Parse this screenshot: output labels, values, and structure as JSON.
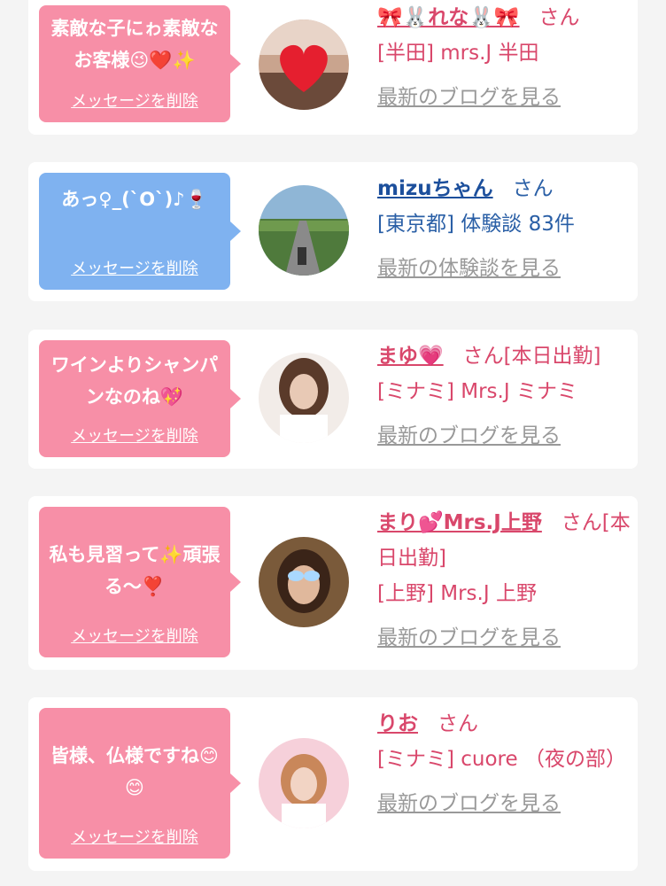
{
  "cards": [
    {
      "message": "素敵な子にゎ素敵なお客様😉❤️✨",
      "delete_label": "メッセージを削除",
      "name": "🎀🐰れな🐰🎀",
      "suffix": "さん",
      "shop": "[半田] mrs.J 半田",
      "link": "最新のブログを見る",
      "avatar_icon": "heart-sticker"
    },
    {
      "message": "あっ♀_(`O`)♪🍷",
      "delete_label": "メッセージを削除",
      "name": "mizuちゃん",
      "suffix": "さん",
      "shop": "[東京都] 体験談 83件",
      "link": "最新の体験談を見る",
      "avatar_icon": "road-landscape"
    },
    {
      "message": "ワインよりシャンパンなのね💖",
      "delete_label": "メッセージを削除",
      "name": "まゆ💗",
      "suffix": "さん[本日出勤]",
      "shop": "[ミナミ] Mrs.J ミナミ",
      "link": "最新のブログを見る",
      "avatar_icon": "person-photo"
    },
    {
      "message": "私も見習って✨頑張る〜❣️",
      "delete_label": "メッセージを削除",
      "name": "まり💕Mrs.J上野",
      "suffix": "さん[本日出勤]",
      "shop": "[上野] Mrs.J 上野",
      "link": "最新のブログを見る",
      "avatar_icon": "person-photo"
    },
    {
      "message": "皆様、仏様ですね😊😊",
      "delete_label": "メッセージを削除",
      "name": "りお",
      "suffix": "さん",
      "shop": "[ミナミ] cuore （夜の部）",
      "link": "最新のブログを見る",
      "avatar_icon": "person-photo"
    }
  ],
  "colors": {
    "pink": "#f78fa7",
    "blue": "#7fb2f0",
    "name_pink": "#d9476b",
    "name_blue": "#1c4f9c",
    "link_gray": "#999999"
  }
}
